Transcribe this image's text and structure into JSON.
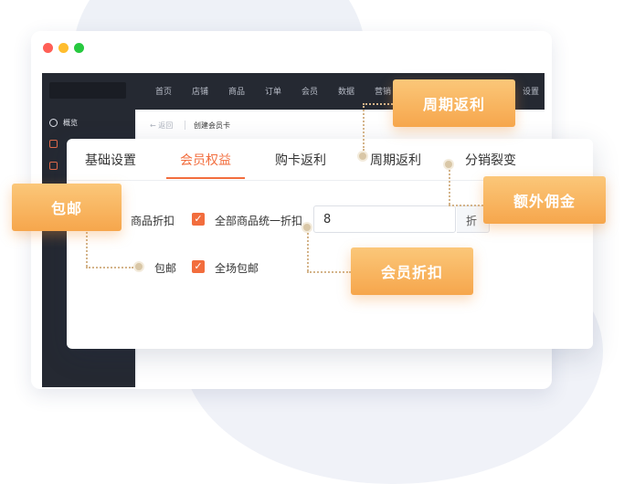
{
  "nav": {
    "items": [
      "首页",
      "店铺",
      "商品",
      "订单",
      "会员",
      "数据",
      "营销",
      "设置"
    ]
  },
  "sidebar": {
    "items": [
      {
        "label": "概览",
        "icon": "clock-icon"
      },
      {
        "label": "",
        "icon": "doc-icon"
      },
      {
        "label": "",
        "icon": "doc-icon"
      }
    ]
  },
  "inner_page": {
    "back_label": "← 返回",
    "breadcrumb": "创建会员卡"
  },
  "card": {
    "tabs": [
      {
        "label": "基础设置",
        "active": false
      },
      {
        "label": "会员权益",
        "active": true
      },
      {
        "label": "购卡返利",
        "active": false
      },
      {
        "label": "周期返利",
        "active": false
      },
      {
        "label": "分销裂变",
        "active": false
      }
    ],
    "discount": {
      "label": "商品折扣",
      "checkbox_label": "全部商品统一折扣",
      "checked": true,
      "value": "8",
      "suffix": "折"
    },
    "shipping": {
      "label": "包邮",
      "checkbox_label": "全场包邮",
      "checked": true
    }
  },
  "callouts": {
    "shipping": "包邮",
    "cycle_rebate": "周期返利",
    "extra_commission": "额外佣金",
    "member_discount": "会员折扣"
  },
  "colors": {
    "accent": "#f26d3d",
    "callout_top": "#fbc779",
    "callout_bottom": "#f6a64c",
    "sidebar_bg": "#252932"
  }
}
